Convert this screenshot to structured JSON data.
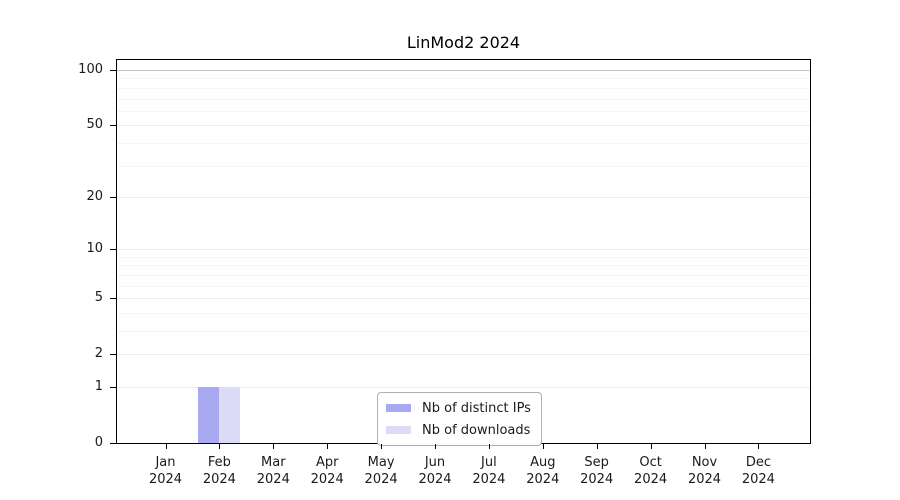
{
  "title": "LinMod2 2024",
  "chart_data": {
    "type": "bar",
    "title": "LinMod2 2024",
    "categories": [
      "Jan 2024",
      "Feb 2024",
      "Mar 2024",
      "Apr 2024",
      "May 2024",
      "Jun 2024",
      "Jul 2024",
      "Aug 2024",
      "Sep 2024",
      "Oct 2024",
      "Nov 2024",
      "Dec 2024"
    ],
    "series": [
      {
        "name": "Nb of distinct IPs",
        "color": "#a9a9f2",
        "values": [
          0,
          1,
          0,
          0,
          0,
          0,
          0,
          0,
          0,
          0,
          0,
          0
        ]
      },
      {
        "name": "Nb of downloads",
        "color": "#dcdcf8",
        "values": [
          0,
          1,
          0,
          0,
          0,
          0,
          0,
          0,
          0,
          0,
          0,
          0
        ]
      }
    ],
    "y_scale": "log10(1+x)",
    "y_ticks": [
      0,
      1,
      2,
      5,
      10,
      20,
      50,
      100
    ],
    "y_minor_gridlines": [
      3,
      4,
      6,
      7,
      8,
      9,
      30,
      40,
      60,
      70,
      80,
      90
    ],
    "ylim": [
      0,
      114
    ],
    "xlabel": "",
    "ylabel": "",
    "grid": true,
    "legend_position": "lower center"
  },
  "colors": {
    "background": "#ffffff",
    "spine": "#000000",
    "text": "#1a1a1a",
    "grid_minor": "#f5f5f5",
    "grid_major": "#ebebeb",
    "grid_100": "#c3c3c3",
    "legend_border": "#b0b0b0"
  }
}
